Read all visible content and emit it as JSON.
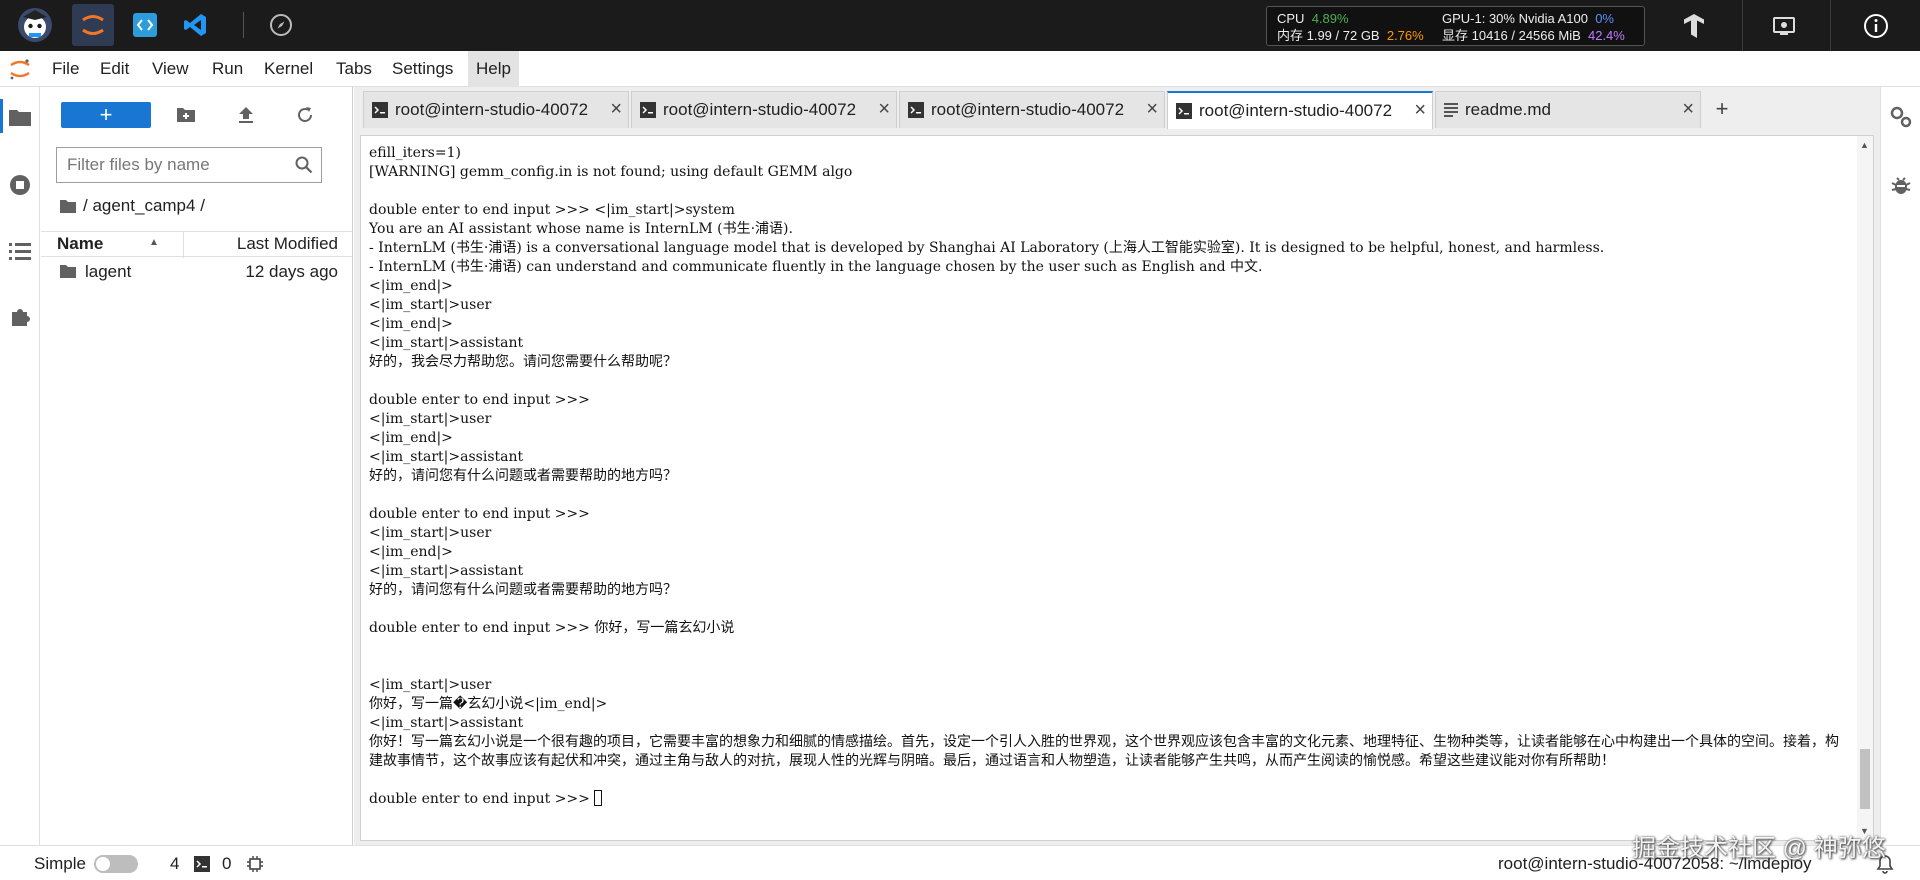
{
  "topbar": {
    "monitor": {
      "cpu_label": "CPU",
      "cpu_value": "4.89%",
      "mem_label": "内存 1.99 / 72 GB",
      "mem_value": "2.76%",
      "gpu_label": "GPU-1: 30% Nvidia A100",
      "gpu_value": "0%",
      "vram_label": "显存 10416 / 24566 MiB",
      "vram_value": "42.4%"
    }
  },
  "menubar": {
    "items": [
      "File",
      "Edit",
      "View",
      "Run",
      "Kernel",
      "Tabs",
      "Settings",
      "Help"
    ]
  },
  "filebrowser": {
    "new_label": "+",
    "filter_placeholder": "Filter files by name",
    "breadcrumb": "/ agent_camp4 /",
    "columns": {
      "name": "Name",
      "modified": "Last Modified"
    },
    "rows": [
      {
        "name": "lagent",
        "modified": "12 days ago"
      }
    ]
  },
  "tabs": [
    {
      "label": "root@intern-studio-40072",
      "close": "×"
    },
    {
      "label": "root@intern-studio-40072",
      "close": "×"
    },
    {
      "label": "root@intern-studio-40072",
      "close": "×"
    },
    {
      "label": "root@intern-studio-40072",
      "close": "×"
    },
    {
      "label": "readme.md",
      "close": "×"
    }
  ],
  "tab_add": "+",
  "terminal": {
    "lines": [
      "efill_iters=1)",
      "[WARNING] gemm_config.in is not found; using default GEMM algo",
      "",
      "double enter to end input >>> <|im_start|>system",
      "You are an AI assistant whose name is InternLM (书生·浦语).",
      "- InternLM (书生·浦语) is a conversational language model that is developed by Shanghai AI Laboratory (上海人工智能实验室). It is designed to be helpful, honest, and harmless.",
      "- InternLM (书生·浦语) can understand and communicate fluently in the language chosen by the user such as English and 中文.",
      "<|im_end|>",
      "<|im_start|>user",
      "<|im_end|>",
      "<|im_start|>assistant",
      "好的，我会尽力帮助您。请问您需要什么帮助呢？",
      "",
      "double enter to end input >>>",
      "<|im_start|>user",
      "<|im_end|>",
      "<|im_start|>assistant",
      "好的，请问您有什么问题或者需要帮助的地方吗？",
      "",
      "double enter to end input >>>",
      "<|im_start|>user",
      "<|im_end|>",
      "<|im_start|>assistant",
      "好的，请问您有什么问题或者需要帮助的地方吗？",
      "",
      "double enter to end input >>> 你好，写一篇玄幻小说",
      "",
      "",
      "<|im_start|>user",
      "你好，写一篇�玄幻小说<|im_end|>",
      "<|im_start|>assistant"
    ],
    "paragraph": "你好！写一篇玄幻小说是一个很有趣的项目，它需要丰富的想象力和细腻的情感描绘。首先，设定一个引人入胜的世界观，这个世界观应该包含丰富的文化元素、地理特征、生物种类等，让读者能够在心中构建出一个具体的空间。接着，构建故事情节，这个故事应该有起伏和冲突，通过主角与敌人的对抗，展现人性的光辉与阴暗。最后，通过语言和人物塑造，让读者能够产生共鸣，从而产生阅读的愉悦感。希望这些建议能对你有所帮助！",
    "prompt": "double enter to end input >>> "
  },
  "statusbar": {
    "mode": "Simple",
    "kernels": "4",
    "terminals": "0",
    "path": "root@intern-studio-40072058: ~/lmdeploy"
  },
  "watermark": "掘金技术社区 @ 神弥悠"
}
